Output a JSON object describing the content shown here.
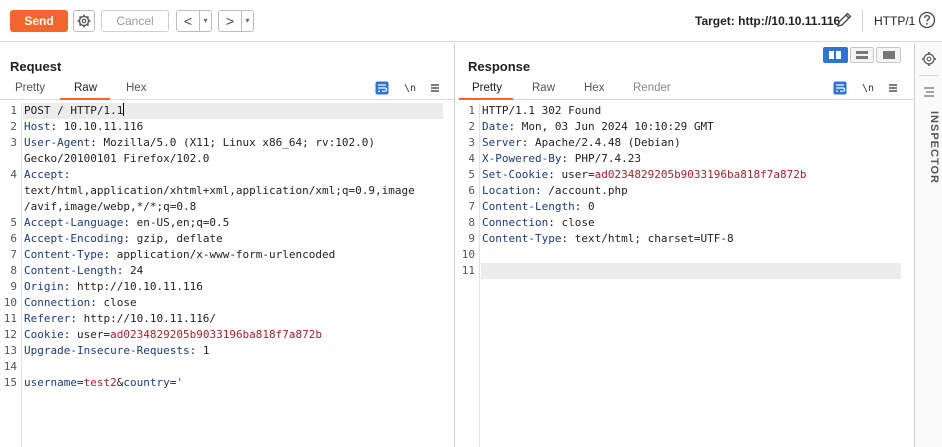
{
  "toolbar": {
    "send_label": "Send",
    "cancel_label": "Cancel",
    "back_arrow": "<",
    "forward_arrow": ">",
    "dropdown_glyph": "▾",
    "target_label": "Target: http://10.10.11.116",
    "http_version": "HTTP/1",
    "icons": [
      "gear-icon",
      "pencil-icon",
      "help-icon"
    ]
  },
  "request": {
    "title": "Request",
    "tabs": [
      {
        "label": "Pretty",
        "active": false
      },
      {
        "label": "Raw",
        "active": true
      },
      {
        "label": "Hex",
        "active": false
      }
    ],
    "newline_toggle": "\\n",
    "lines": [
      {
        "num": "1",
        "key": "",
        "rest": "POST / HTTP/1.1"
      },
      {
        "num": "2",
        "key": "Host",
        "rest": ": 10.10.11.116"
      },
      {
        "num": "3",
        "key": "User-Agent",
        "rest": ": Mozilla/5.0 (X11; Linux x86_64; rv:102.0)"
      },
      {
        "num": "",
        "key": "",
        "rest": "Gecko/20100101 Firefox/102.0"
      },
      {
        "num": "4",
        "key": "Accept",
        "rest": ":"
      },
      {
        "num": "",
        "key": "",
        "rest": "text/html,application/xhtml+xml,application/xml;q=0.9,image"
      },
      {
        "num": "",
        "key": "",
        "rest": "/avif,image/webp,*/*;q=0.8"
      },
      {
        "num": "5",
        "key": "Accept-Language",
        "rest": ": en-US,en;q=0.5"
      },
      {
        "num": "6",
        "key": "Accept-Encoding",
        "rest": ": gzip, deflate"
      },
      {
        "num": "7",
        "key": "Content-Type",
        "rest": ": application/x-www-form-urlencoded"
      },
      {
        "num": "8",
        "key": "Content-Length",
        "rest": ": 24"
      },
      {
        "num": "9",
        "key": "Origin",
        "rest": ": http://10.10.11.116"
      },
      {
        "num": "10",
        "key": "Connection",
        "rest": ": close"
      },
      {
        "num": "11",
        "key": "Referer",
        "rest": ": http://10.10.11.116/"
      },
      {
        "num": "12",
        "key": "Cookie",
        "rest": ": user=",
        "cookie": "ad0234829205b9033196ba818f7a872b"
      },
      {
        "num": "13",
        "key": "Upgrade-Insecure-Requests",
        "rest": ": 1"
      },
      {
        "num": "14",
        "key": "",
        "rest": ""
      },
      {
        "num": "15",
        "key": "",
        "rest": "",
        "body": true,
        "b1": "username",
        "b2": "=",
        "b3": "test2",
        "b4": "&",
        "b5": "country",
        "b6": "=",
        "b7": "'"
      }
    ]
  },
  "response": {
    "title": "Response",
    "tabs": [
      {
        "label": "Pretty",
        "active": true
      },
      {
        "label": "Raw",
        "active": false
      },
      {
        "label": "Hex",
        "active": false
      },
      {
        "label": "Render",
        "active": false
      }
    ],
    "newline_toggle": "\\n",
    "lines": [
      {
        "num": "1",
        "key": "",
        "rest": "HTTP/1.1 302 Found"
      },
      {
        "num": "2",
        "key": "Date",
        "rest": ": Mon, 03 Jun 2024 10:10:29 GMT"
      },
      {
        "num": "3",
        "key": "Server",
        "rest": ": Apache/2.4.48 (Debian)"
      },
      {
        "num": "4",
        "key": "X-Powered-By",
        "rest": ": PHP/7.4.23"
      },
      {
        "num": "5",
        "key": "Set-Cookie",
        "rest": ": user=",
        "cookie": "ad0234829205b9033196ba818f7a872b"
      },
      {
        "num": "6",
        "key": "Location",
        "rest": ": /account.php"
      },
      {
        "num": "7",
        "key": "Content-Length",
        "rest": ": 0"
      },
      {
        "num": "8",
        "key": "Connection",
        "rest": ": close"
      },
      {
        "num": "9",
        "key": "Content-Type",
        "rest": ": text/html; charset=UTF-8"
      },
      {
        "num": "10",
        "key": "",
        "rest": ""
      },
      {
        "num": "11",
        "key": "",
        "rest": ""
      }
    ]
  },
  "inspector": {
    "label": "INSPECTOR"
  },
  "colors": {
    "accent": "#f2662c",
    "header_key": "#1c3a7c",
    "cookie_value": "#a7212b",
    "layout_active": "#2f74d0"
  }
}
